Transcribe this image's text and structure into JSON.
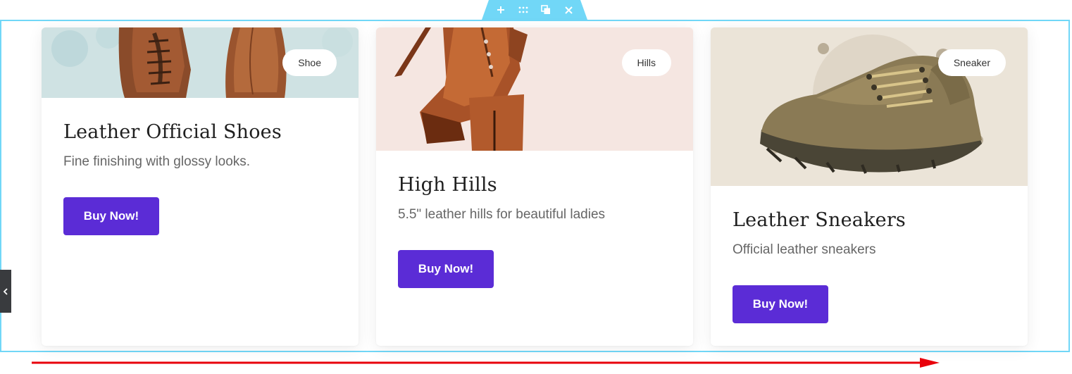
{
  "editor": {
    "handle_icons": [
      "plus-icon",
      "drag-handle-icon",
      "duplicate-icon",
      "close-icon"
    ],
    "accent_color": "#71d7f7",
    "side_tab_icon": "chevron-left-icon"
  },
  "cards": [
    {
      "badge": "Shoe",
      "title": "Leather Official Shoes",
      "description": "Fine finishing with glossy looks.",
      "button_label": "Buy Now!"
    },
    {
      "badge": "Hills",
      "title": "High Hills",
      "description": "5.5\" leather hills for beautiful ladies",
      "button_label": "Buy Now!"
    },
    {
      "badge": "Sneaker",
      "title": "Leather Sneakers",
      "description": "Official leather sneakers",
      "button_label": "Buy Now!"
    }
  ],
  "colors": {
    "button": "#5b2cd6",
    "annotation_arrow": "#e8000b"
  }
}
